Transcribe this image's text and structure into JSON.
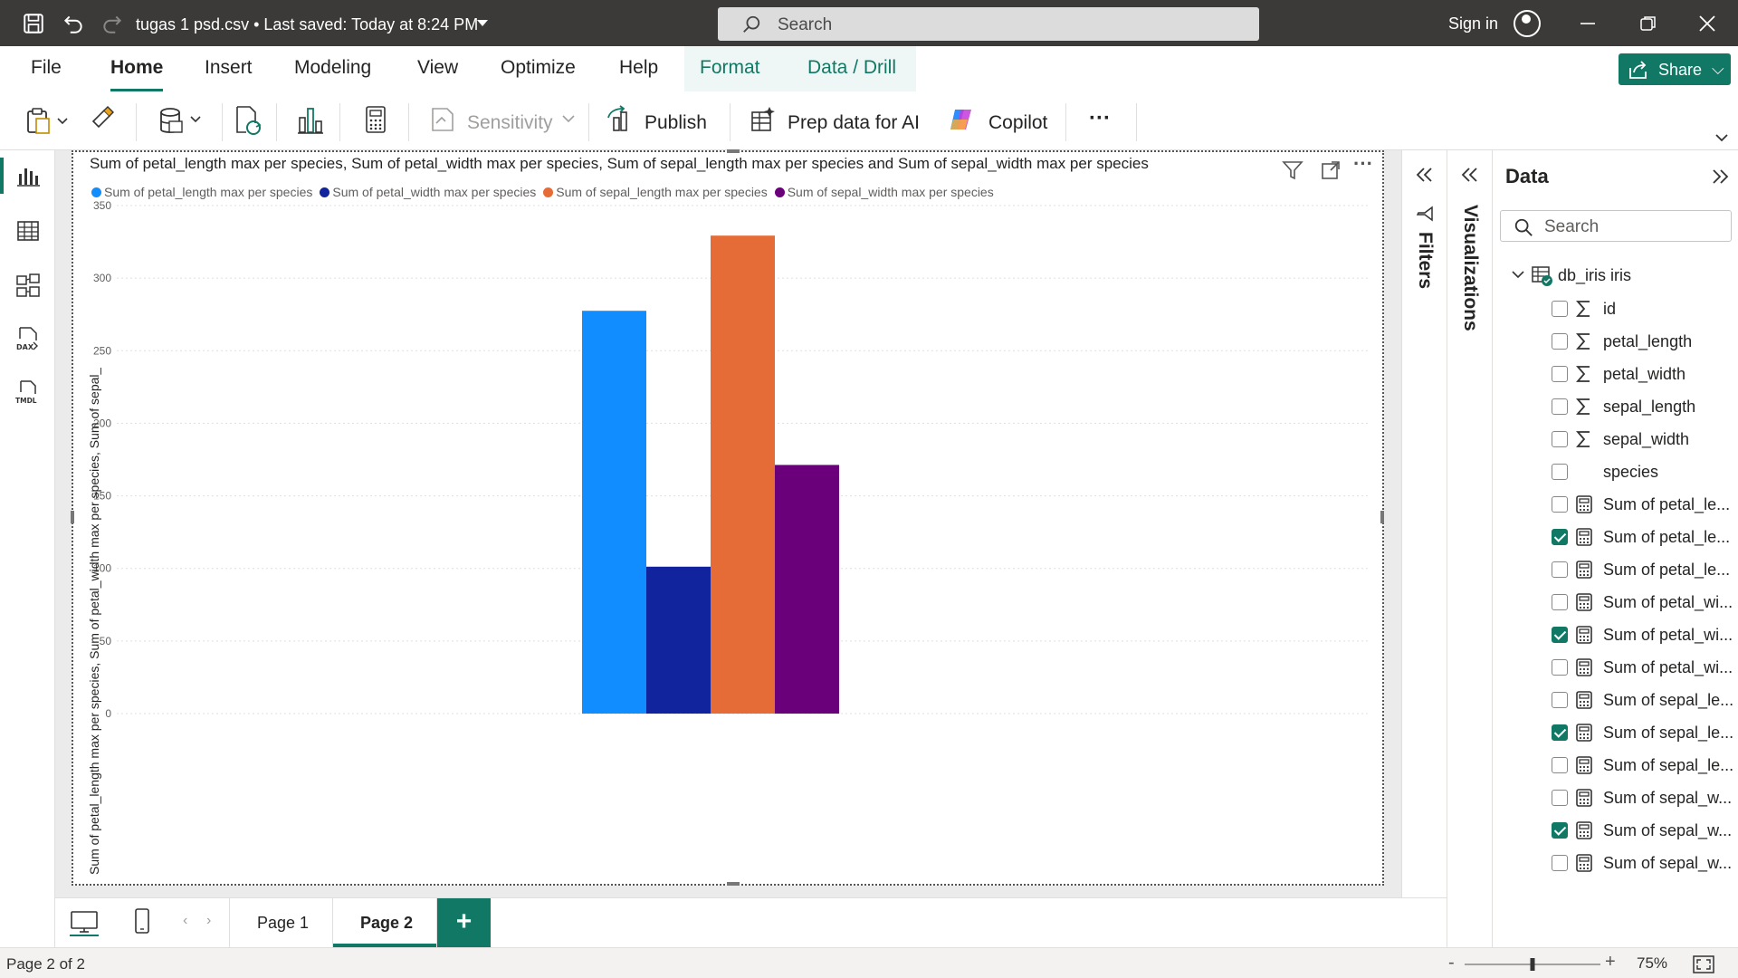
{
  "titlebar": {
    "doc_title": "tugas 1 psd.csv • Last saved: Today at 8:24 PM",
    "search_placeholder": "Search",
    "sign_in": "Sign in"
  },
  "tabs": [
    {
      "label": "File"
    },
    {
      "label": "Home"
    },
    {
      "label": "Insert"
    },
    {
      "label": "Modeling"
    },
    {
      "label": "View"
    },
    {
      "label": "Optimize"
    },
    {
      "label": "Help"
    },
    {
      "label": "Format"
    },
    {
      "label": "Data / Drill"
    }
  ],
  "share_label": "Share",
  "toolbar": {
    "sensitivity": "Sensitivity",
    "publish": "Publish",
    "prep_data": "Prep data for AI",
    "copilot": "Copilot",
    "more": "···"
  },
  "visual": {
    "title": "Sum of petal_length max per species, Sum of petal_width max per species, Sum of sepal_length max per species and Sum of sepal_width max per species",
    "ylabel": "Sum of petal_length max per species, Sum of petal_width max per species, Sum of sepal_length ma..."
  },
  "chart_data": {
    "type": "bar",
    "title": "Sum of petal_length max per species, Sum of petal_width max per species, Sum of sepal_length max per species and Sum of sepal_width max per species",
    "ylabel": "Sum of petal_length max per species, Sum of petal_width max per species, Sum of sepal_length ma...",
    "xlabel": "",
    "ylim": [
      0,
      350
    ],
    "yticks": [
      0,
      50,
      100,
      150,
      200,
      250,
      300,
      350
    ],
    "grid": true,
    "legend_position": "top-left",
    "series": [
      {
        "name": "Sum of petal_length max per species",
        "color": "#118dff",
        "value": 277.5
      },
      {
        "name": "Sum of petal_width max per species",
        "color": "#12239e",
        "value": 101.2
      },
      {
        "name": "Sum of sepal_length max per species",
        "color": "#e66c37",
        "value": 329.3
      },
      {
        "name": "Sum of sepal_width max per species",
        "color": "#6b007b",
        "value": 171.3
      }
    ]
  },
  "pages": [
    {
      "label": "Page 1"
    },
    {
      "label": "Page 2"
    }
  ],
  "add_page": "+",
  "panels": {
    "filters": "Filters",
    "visualizations": "Visualizations",
    "data_title": "Data",
    "data_search_placeholder": "Search"
  },
  "data_tree": {
    "table": "db_iris iris",
    "fields": [
      {
        "name": "id",
        "kind": "sigma",
        "checked": false
      },
      {
        "name": "petal_length",
        "kind": "sigma",
        "checked": false
      },
      {
        "name": "petal_width",
        "kind": "sigma",
        "checked": false
      },
      {
        "name": "sepal_length",
        "kind": "sigma",
        "checked": false
      },
      {
        "name": "sepal_width",
        "kind": "sigma",
        "checked": false
      },
      {
        "name": "species",
        "kind": "none",
        "checked": false
      },
      {
        "name": "Sum of petal_le...",
        "kind": "measure",
        "checked": false
      },
      {
        "name": "Sum of petal_le...",
        "kind": "measure",
        "checked": true
      },
      {
        "name": "Sum of petal_le...",
        "kind": "measure",
        "checked": false
      },
      {
        "name": "Sum of petal_wi...",
        "kind": "measure",
        "checked": false
      },
      {
        "name": "Sum of petal_wi...",
        "kind": "measure",
        "checked": true
      },
      {
        "name": "Sum of petal_wi...",
        "kind": "measure",
        "checked": false
      },
      {
        "name": "Sum of sepal_le...",
        "kind": "measure",
        "checked": false
      },
      {
        "name": "Sum of sepal_le...",
        "kind": "measure",
        "checked": true
      },
      {
        "name": "Sum of sepal_le...",
        "kind": "measure",
        "checked": false
      },
      {
        "name": "Sum of sepal_w...",
        "kind": "measure",
        "checked": false
      },
      {
        "name": "Sum of sepal_w...",
        "kind": "measure",
        "checked": true
      },
      {
        "name": "Sum of sepal_w...",
        "kind": "measure",
        "checked": false
      }
    ]
  },
  "status": {
    "page_info": "Page 2 of 2",
    "zoom": "75%",
    "zoom_level": 0.75
  },
  "colors": {
    "accent": "#117865",
    "titlebar": "#3b3a39"
  }
}
